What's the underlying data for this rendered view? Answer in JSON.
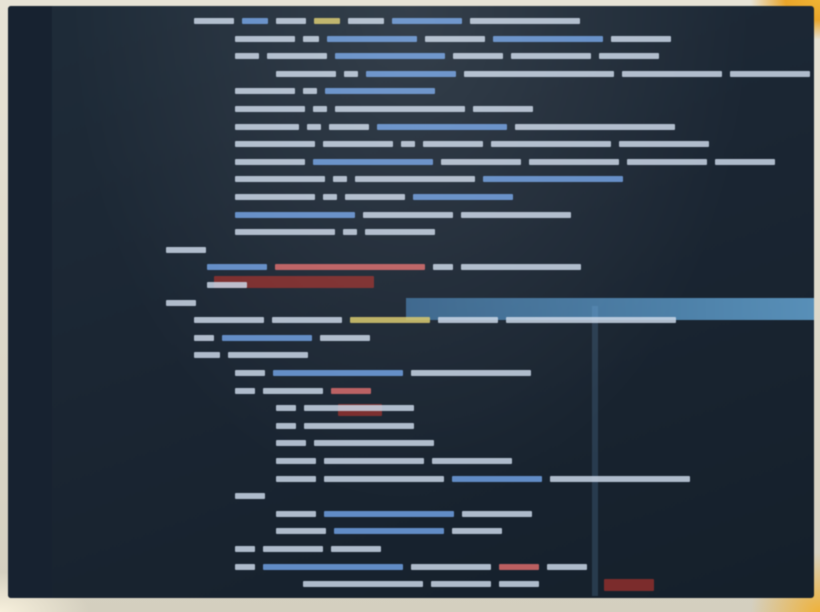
{
  "photo": {
    "subject": "monitor",
    "colors": {
      "wall": "#d9d4c6",
      "screen_bg": "#1b2633",
      "accent_orange": "#f1b434",
      "highlight_blue": "#5aa0d6",
      "string_red": "#7b2c2c",
      "code_text": "#c9d6e6",
      "keyword_blue": "#6f9fe0",
      "keyword_yellow": "#d8c86a"
    }
  },
  "code_lines": [
    {
      "indent": 14,
      "tokens": [
        [
          "#c9d6e6",
          40
        ],
        [
          "#6f9fe0",
          26
        ],
        [
          "#c9d6e6",
          30
        ],
        [
          "#d8c86a",
          26
        ],
        [
          "#c9d6e6",
          36
        ],
        [
          "#6f9fe0",
          70
        ],
        [
          "#c9d6e6",
          110
        ]
      ]
    },
    {
      "indent": 20,
      "tokens": [
        [
          "#c9d6e6",
          60
        ],
        [
          "#c9d6e6",
          16
        ],
        [
          "#6f9fe0",
          90
        ],
        [
          "#c9d6e6",
          60
        ],
        [
          "#6f9fe0",
          110
        ],
        [
          "#c9d6e6",
          60
        ]
      ]
    },
    {
      "indent": 20,
      "tokens": [
        [
          "#c9d6e6",
          24
        ],
        [
          "#c9d6e6",
          60
        ],
        [
          "#6f9fe0",
          110
        ],
        [
          "#c9d6e6",
          50
        ],
        [
          "#c9d6e6",
          80
        ],
        [
          "#c9d6e6",
          60
        ]
      ]
    },
    {
      "indent": 26,
      "tokens": [
        [
          "#c9d6e6",
          60
        ],
        [
          "#c9d6e6",
          14
        ],
        [
          "#6f9fe0",
          90
        ],
        [
          "#c9d6e6",
          150
        ],
        [
          "#c9d6e6",
          100
        ],
        [
          "#c9d6e6",
          80
        ]
      ]
    },
    {
      "indent": 20,
      "tokens": [
        [
          "#c9d6e6",
          60
        ],
        [
          "#c9d6e6",
          14
        ],
        [
          "#6f9fe0",
          110
        ]
      ]
    },
    {
      "indent": 20,
      "tokens": [
        [
          "#c9d6e6",
          70
        ],
        [
          "#c9d6e6",
          14
        ],
        [
          "#c9d6e6",
          130
        ],
        [
          "#c9d6e6",
          60
        ]
      ]
    },
    {
      "indent": 20,
      "tokens": [
        [
          "#c9d6e6",
          64
        ],
        [
          "#c9d6e6",
          14
        ],
        [
          "#c9d6e6",
          40
        ],
        [
          "#6f9fe0",
          130
        ],
        [
          "#c9d6e6",
          160
        ]
      ]
    },
    {
      "indent": 20,
      "tokens": [
        [
          "#c9d6e6",
          80
        ],
        [
          "#c9d6e6",
          70
        ],
        [
          "#c9d6e6",
          14
        ],
        [
          "#c9d6e6",
          60
        ],
        [
          "#c9d6e6",
          120
        ],
        [
          "#c9d6e6",
          90
        ]
      ]
    },
    {
      "indent": 20,
      "tokens": [
        [
          "#c9d6e6",
          70
        ],
        [
          "#6f9fe0",
          120
        ],
        [
          "#c9d6e6",
          80
        ],
        [
          "#c9d6e6",
          90
        ],
        [
          "#c9d6e6",
          80
        ],
        [
          "#c9d6e6",
          60
        ]
      ]
    },
    {
      "indent": 20,
      "tokens": [
        [
          "#c9d6e6",
          90
        ],
        [
          "#c9d6e6",
          14
        ],
        [
          "#c9d6e6",
          120
        ],
        [
          "#6f9fe0",
          140
        ]
      ]
    },
    {
      "indent": 20,
      "tokens": [
        [
          "#c9d6e6",
          80
        ],
        [
          "#c9d6e6",
          14
        ],
        [
          "#c9d6e6",
          60
        ],
        [
          "#6f9fe0",
          100
        ]
      ]
    },
    {
      "indent": 20,
      "tokens": [
        [
          "#6f9fe0",
          120
        ],
        [
          "#c9d6e6",
          90
        ],
        [
          "#c9d6e6",
          110
        ]
      ]
    },
    {
      "indent": 20,
      "tokens": [
        [
          "#c9d6e6",
          100
        ],
        [
          "#c9d6e6",
          14
        ],
        [
          "#c9d6e6",
          70
        ]
      ]
    },
    {
      "indent": 10,
      "tokens": [
        [
          "#c9d6e6",
          40
        ]
      ]
    },
    {
      "indent": 16,
      "tokens": [
        [
          "#6f9fe0",
          60
        ],
        [
          "#d86a6a",
          150
        ],
        [
          "#c9d6e6",
          20
        ],
        [
          "#c9d6e6",
          120
        ]
      ]
    },
    {
      "indent": 16,
      "tokens": [
        [
          "#c9d6e6",
          40
        ]
      ]
    },
    {
      "indent": 10,
      "tokens": [
        [
          "#c9d6e6",
          30
        ]
      ]
    },
    {
      "indent": 14,
      "tokens": [
        [
          "#c9d6e6",
          70
        ],
        [
          "#c9d6e6",
          70
        ],
        [
          "#d8c86a",
          80
        ],
        [
          "#c9d6e6",
          60
        ],
        [
          "#c9d6e6",
          170
        ]
      ]
    },
    {
      "indent": 14,
      "tokens": [
        [
          "#c9d6e6",
          20
        ],
        [
          "#6f9fe0",
          90
        ],
        [
          "#c9d6e6",
          50
        ]
      ]
    },
    {
      "indent": 14,
      "tokens": [
        [
          "#c9d6e6",
          26
        ],
        [
          "#c9d6e6",
          80
        ]
      ]
    },
    {
      "indent": 20,
      "tokens": [
        [
          "#c9d6e6",
          30
        ],
        [
          "#6f9fe0",
          130
        ],
        [
          "#c9d6e6",
          120
        ]
      ]
    },
    {
      "indent": 20,
      "tokens": [
        [
          "#c9d6e6",
          20
        ],
        [
          "#c9d6e6",
          60
        ],
        [
          "#d86a6a",
          40
        ]
      ]
    },
    {
      "indent": 26,
      "tokens": [
        [
          "#c9d6e6",
          20
        ],
        [
          "#c9d6e6",
          110
        ]
      ]
    },
    {
      "indent": 26,
      "tokens": [
        [
          "#c9d6e6",
          20
        ],
        [
          "#c9d6e6",
          110
        ]
      ]
    },
    {
      "indent": 26,
      "tokens": [
        [
          "#c9d6e6",
          30
        ],
        [
          "#c9d6e6",
          120
        ]
      ]
    },
    {
      "indent": 26,
      "tokens": [
        [
          "#c9d6e6",
          40
        ],
        [
          "#c9d6e6",
          100
        ],
        [
          "#c9d6e6",
          80
        ]
      ]
    },
    {
      "indent": 26,
      "tokens": [
        [
          "#c9d6e6",
          40
        ],
        [
          "#c9d6e6",
          120
        ],
        [
          "#6f9fe0",
          90
        ],
        [
          "#c9d6e6",
          140
        ]
      ]
    },
    {
      "indent": 20,
      "tokens": [
        [
          "#c9d6e6",
          30
        ]
      ]
    },
    {
      "indent": 26,
      "tokens": [
        [
          "#c9d6e6",
          40
        ],
        [
          "#6f9fe0",
          130
        ],
        [
          "#c9d6e6",
          70
        ]
      ]
    },
    {
      "indent": 26,
      "tokens": [
        [
          "#c9d6e6",
          50
        ],
        [
          "#6f9fe0",
          110
        ],
        [
          "#c9d6e6",
          50
        ]
      ]
    },
    {
      "indent": 20,
      "tokens": [
        [
          "#c9d6e6",
          20
        ],
        [
          "#c9d6e6",
          60
        ],
        [
          "#c9d6e6",
          50
        ]
      ]
    },
    {
      "indent": 20,
      "tokens": [
        [
          "#c9d6e6",
          20
        ],
        [
          "#6f9fe0",
          140
        ],
        [
          "#c9d6e6",
          80
        ],
        [
          "#d86a6a",
          40
        ],
        [
          "#c9d6e6",
          40
        ]
      ]
    },
    {
      "indent": 30,
      "tokens": [
        [
          "#c9d6e6",
          120
        ],
        [
          "#c9d6e6",
          60
        ],
        [
          "#c9d6e6",
          40
        ]
      ]
    }
  ]
}
